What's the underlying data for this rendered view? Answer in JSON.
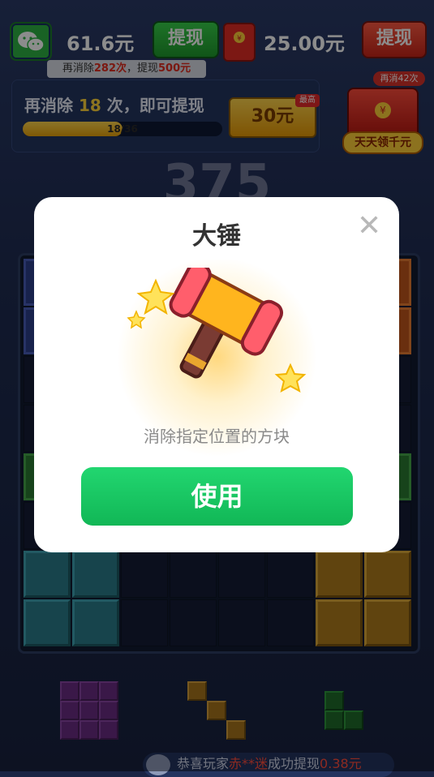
{
  "topbar": {
    "wechat_icon": "wechat-icon",
    "balance": "61.6元",
    "withdraw_label": "提现",
    "red_packet_icon": "red-packet-icon",
    "red_balance": "25.00元",
    "red_withdraw_label": "提现",
    "hint_prefix": "再消除",
    "hint_count": "282次",
    "hint_middle": "，提现",
    "hint_amount": "500元"
  },
  "progress": {
    "title_prefix": "再消除 ",
    "title_count": "18",
    "title_suffix": " 次，即可提现",
    "current": 18,
    "total": 36,
    "fraction": 0.5,
    "text": "18/36",
    "prize": "30元",
    "prize_tag": "最高"
  },
  "gift": {
    "tag": "再消42次",
    "label": "天天领千元"
  },
  "score": "375",
  "ticker": {
    "prefix": "恭喜玩家",
    "name": "赤**迷",
    "middle": "成功提现",
    "amount": "0.38元"
  },
  "modal": {
    "title": "大锤",
    "close_icon": "close-icon",
    "item_icon": "hammer-icon",
    "description": "消除指定位置的方块",
    "use_label": "使用"
  },
  "colors": {
    "use_button": "#17c45f",
    "modal_bg": "#ffffff",
    "board_bg": "#111a30"
  }
}
